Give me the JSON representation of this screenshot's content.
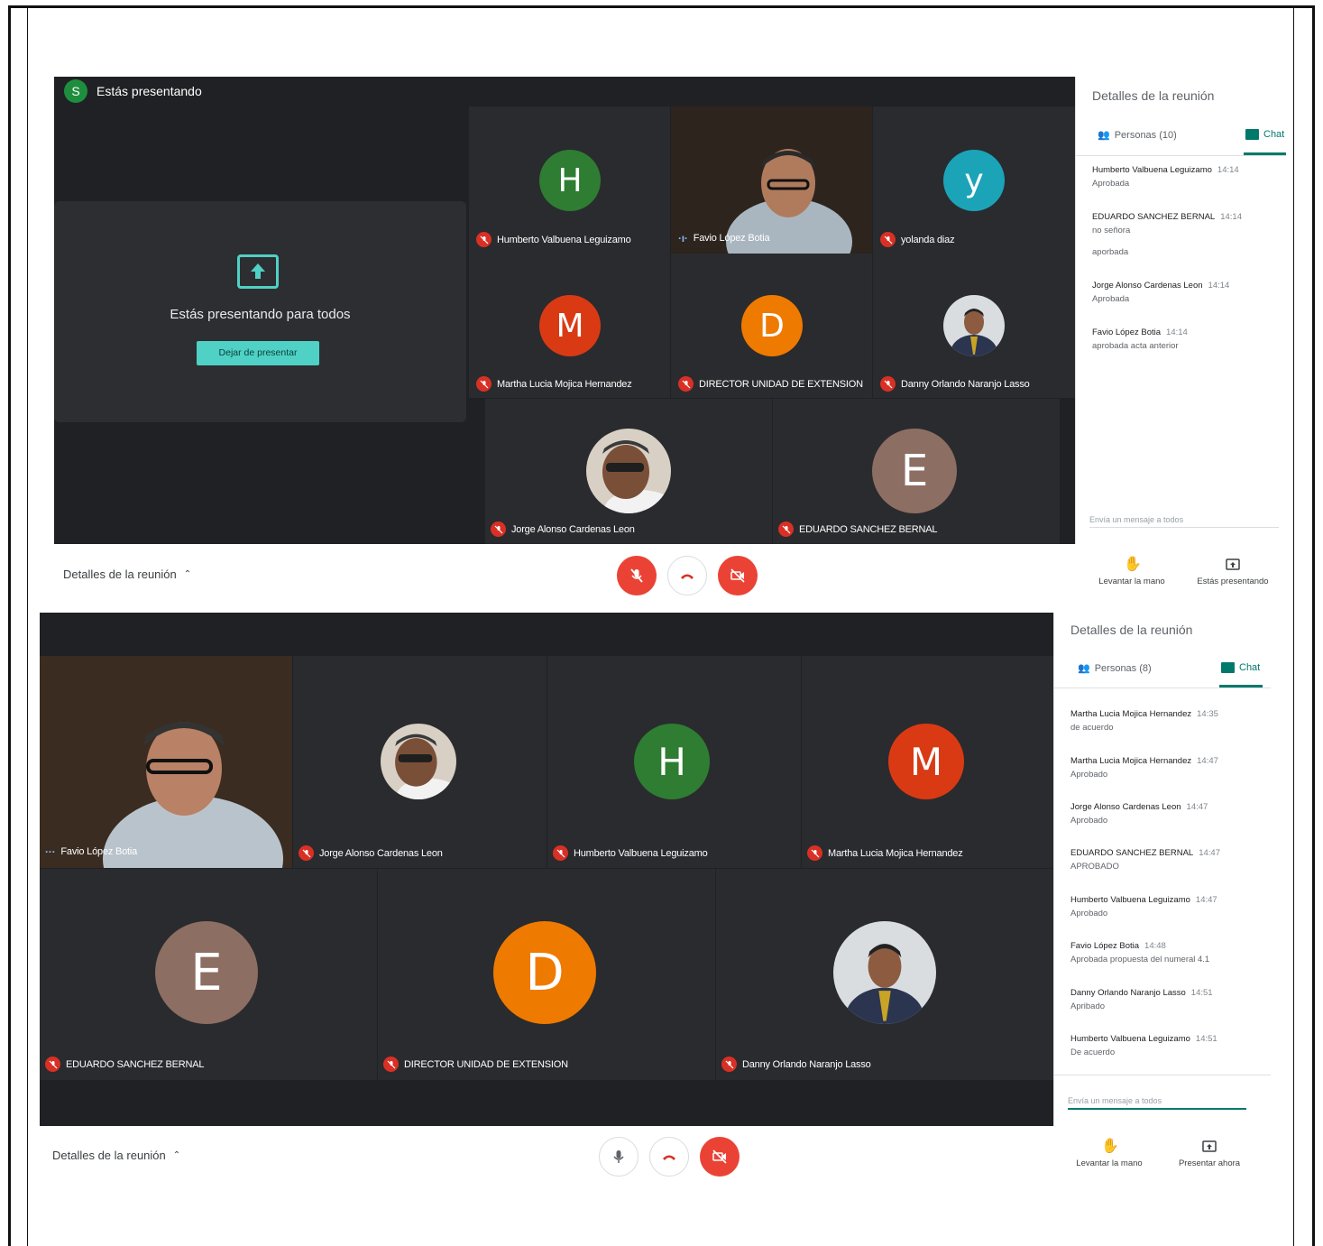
{
  "top": {
    "presenting_header": "Estás presentando",
    "presenter_initial": "S",
    "present_card_text": "Estás presentando para todos",
    "stop_presenting_label": "Dejar de presentar",
    "tiles": [
      {
        "name": "Humberto Valbuena Leguizamo",
        "initial": "H",
        "color": "#2e7d32"
      },
      {
        "name": "Favio López Botia"
      },
      {
        "name": "yolanda diaz",
        "initial": "y",
        "color": "#1ba4b8"
      },
      {
        "name": "Martha Lucia Mojica Hernandez",
        "initial": "M",
        "color": "#d93a14"
      },
      {
        "name": "DIRECTOR UNIDAD DE EXTENSION",
        "initial": "D",
        "color": "#ef7a00"
      },
      {
        "name": "Danny Orlando Naranjo Lasso"
      },
      {
        "name": "Jorge Alonso Cardenas Leon"
      },
      {
        "name": "EDUARDO SANCHEZ BERNAL",
        "initial": "E",
        "color": "#8d6e63"
      }
    ],
    "panel": {
      "title": "Detalles de la reunión",
      "people_tab": "Personas (10)",
      "chat_tab": "Chat",
      "messages": [
        {
          "who": "Humberto Valbuena Leguizamo",
          "time": "14:14",
          "lines": [
            "Aprobada"
          ]
        },
        {
          "who": "EDUARDO SANCHEZ BERNAL",
          "time": "14:14",
          "lines": [
            "no señora",
            "aporbada"
          ]
        },
        {
          "who": "Jorge Alonso Cardenas Leon",
          "time": "14:14",
          "lines": [
            "Aprobada"
          ]
        },
        {
          "who": "Favio López Botia",
          "time": "14:14",
          "lines": [
            "aprobada acta anterior"
          ]
        }
      ],
      "compose_placeholder": "Envía un mensaje a todos"
    },
    "bar": {
      "details": "Detalles de la reunión",
      "raise_hand": "Levantar la mano",
      "present_action": "Estás presentando"
    }
  },
  "bottom": {
    "tiles": [
      {
        "name": "Favio López Botia"
      },
      {
        "name": "Jorge Alonso Cardenas Leon"
      },
      {
        "name": "Humberto Valbuena Leguizamo",
        "initial": "H",
        "color": "#2e7d32"
      },
      {
        "name": "Martha Lucia Mojica Hernandez",
        "initial": "M",
        "color": "#d93a14"
      },
      {
        "name": "EDUARDO SANCHEZ BERNAL",
        "initial": "E",
        "color": "#8d6e63"
      },
      {
        "name": "DIRECTOR UNIDAD DE EXTENSION",
        "initial": "D",
        "color": "#ef7a00"
      },
      {
        "name": "Danny Orlando Naranjo Lasso"
      }
    ],
    "panel": {
      "title": "Detalles de la reunión",
      "people_tab": "Personas (8)",
      "chat_tab": "Chat",
      "messages": [
        {
          "who": "Martha Lucia Mojica Hernandez",
          "time": "14:35",
          "lines": [
            "de acuerdo"
          ]
        },
        {
          "who": "Martha Lucia Mojica Hernandez",
          "time": "14:47",
          "lines": [
            "Aprobado"
          ]
        },
        {
          "who": "Jorge Alonso Cardenas Leon",
          "time": "14:47",
          "lines": [
            "Aprobado"
          ]
        },
        {
          "who": "EDUARDO SANCHEZ BERNAL",
          "time": "14:47",
          "lines": [
            "APROBADO"
          ]
        },
        {
          "who": "Humberto Valbuena Leguizamo",
          "time": "14:47",
          "lines": [
            "Aprobado"
          ]
        },
        {
          "who": "Favio López Botia",
          "time": "14:48",
          "lines": [
            "Aprobada propuesta del numeral 4.1"
          ]
        },
        {
          "who": "Danny Orlando Naranjo Lasso",
          "time": "14:51",
          "lines": [
            "Apribado"
          ]
        },
        {
          "who": "Humberto Valbuena Leguizamo",
          "time": "14:51",
          "lines": [
            "De acuerdo"
          ]
        }
      ],
      "compose_placeholder": "Envía un mensaje a todos"
    },
    "bar": {
      "details": "Detalles de la reunión",
      "raise_hand": "Levantar la mano",
      "present_action": "Presentar ahora"
    }
  }
}
